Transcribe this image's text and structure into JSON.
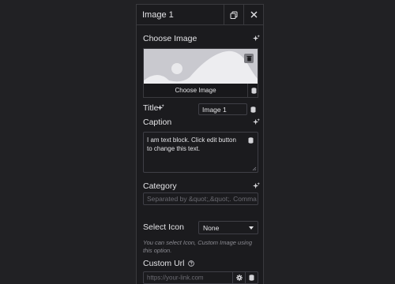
{
  "header": {
    "title": "Image 1"
  },
  "choose_image": {
    "label": "Choose Image",
    "button_label": "Choose Image"
  },
  "title_field": {
    "label": "Title",
    "value": "Image 1"
  },
  "caption": {
    "label": "Caption",
    "value": "I am text block. Click edit button to change this text."
  },
  "category": {
    "label": "Category",
    "placeholder": "Separated by &quot;,&quot;. Comma"
  },
  "select_icon": {
    "label": "Select Icon",
    "value": "None",
    "help": "You can select Icon, Custom Image using this option."
  },
  "custom_url": {
    "label": "Custom Url",
    "placeholder": "https://your-link.com"
  },
  "colors": {
    "background": "#212124",
    "panel": "#1b1b1e",
    "border": "#3a3a3e",
    "image_placeholder": "#c9c9cf"
  }
}
